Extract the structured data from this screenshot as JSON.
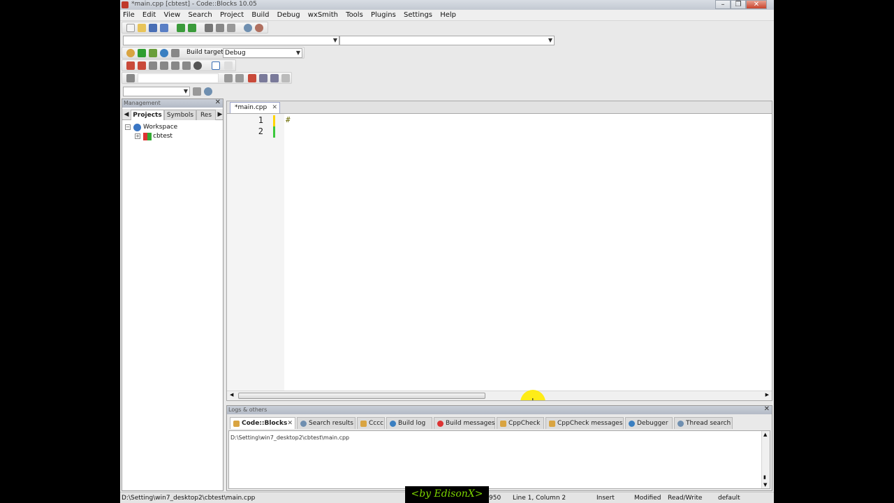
{
  "window": {
    "title": "*main.cpp [cbtest] - Code::Blocks 10.05"
  },
  "window_buttons": {
    "minimize": "–",
    "maximize": "❐",
    "close": "✕"
  },
  "menu": [
    "File",
    "Edit",
    "View",
    "Search",
    "Project",
    "Build",
    "Debug",
    "wxSmith",
    "Tools",
    "Plugins",
    "Settings",
    "Help"
  ],
  "build_toolbar": {
    "label": "Build target:",
    "target": "Debug"
  },
  "management": {
    "title": "Management",
    "tabs": [
      "Projects",
      "Symbols",
      "Res"
    ],
    "tree": {
      "workspace": "Workspace",
      "project": "cbtest"
    }
  },
  "editor": {
    "tab_label": "*main.cpp",
    "lines": [
      {
        "no": "1",
        "code": "#"
      },
      {
        "no": "2",
        "code": ""
      }
    ]
  },
  "logs": {
    "title": "Logs & others",
    "tabs": [
      "Code::Blocks",
      "Search results",
      "Cccc",
      "Build log",
      "Build messages",
      "CppCheck",
      "CppCheck messages",
      "Debugger",
      "Thread search"
    ],
    "content": "D:\\Setting\\win7_desktop2\\cbtest\\main.cpp"
  },
  "status": {
    "path": "D:\\Setting\\win7_desktop2\\cbtest\\main.cpp",
    "encoding": "950",
    "position": "Line 1, Column 2",
    "mode": "Insert",
    "modified": "Modified",
    "access": "Read/Write",
    "lang": "default"
  },
  "watermark": "<by EdisonX>",
  "colors": {
    "accent": "#ffeb00",
    "watermark": "#7cd400"
  }
}
